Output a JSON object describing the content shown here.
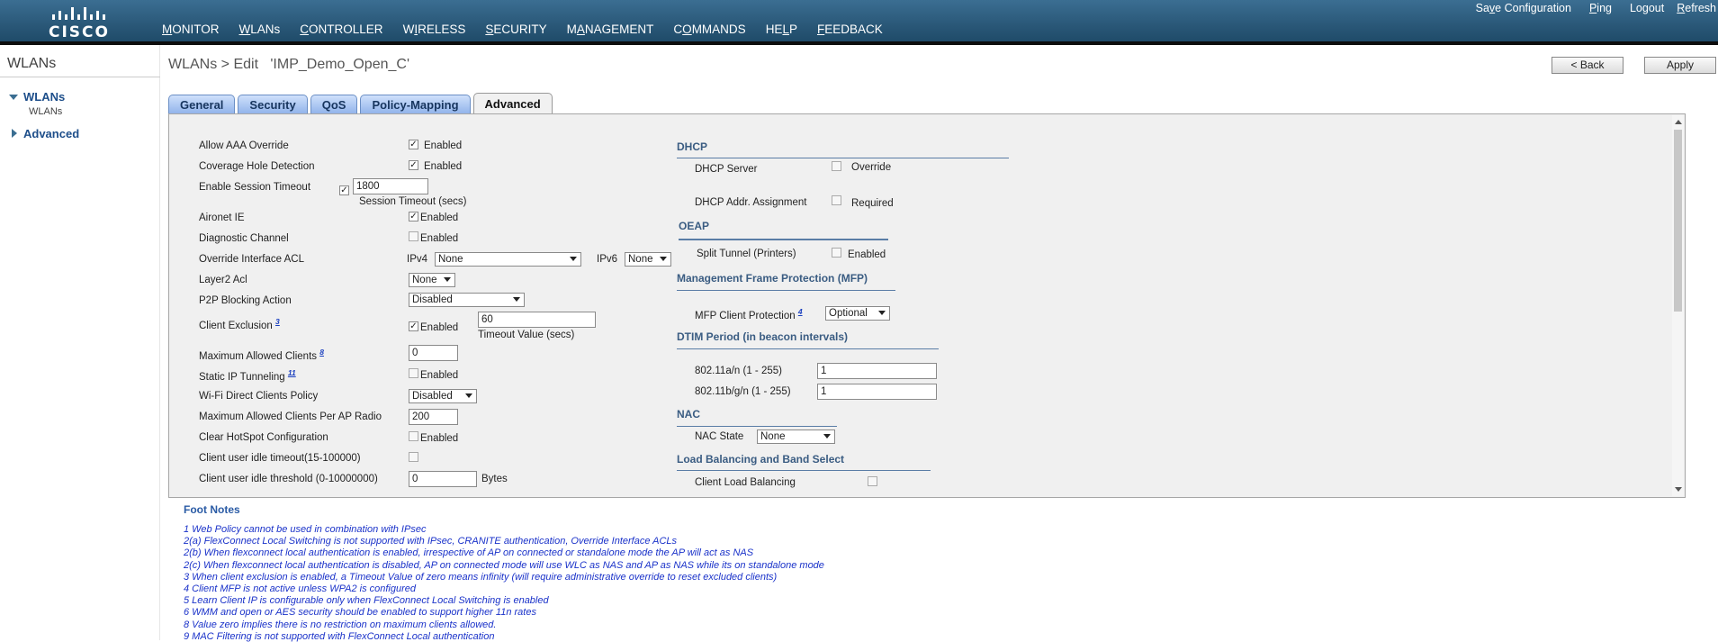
{
  "brand": "CISCO",
  "nav": {
    "main": [
      {
        "pre": "",
        "u": "M",
        "post": "ONITOR"
      },
      {
        "pre": "",
        "u": "W",
        "post": "LANs"
      },
      {
        "pre": "",
        "u": "C",
        "post": "ONTROLLER"
      },
      {
        "pre": "W",
        "u": "I",
        "post": "RELESS"
      },
      {
        "pre": "",
        "u": "S",
        "post": "ECURITY"
      },
      {
        "pre": "M",
        "u": "A",
        "post": "NAGEMENT"
      },
      {
        "pre": "C",
        "u": "O",
        "post": "MMANDS"
      },
      {
        "pre": "HE",
        "u": "L",
        "post": "P"
      },
      {
        "pre": "",
        "u": "F",
        "post": "EEDBACK"
      }
    ],
    "util": [
      {
        "pre": "Sa",
        "u": "v",
        "post": "e Configuration"
      },
      {
        "pre": "",
        "u": "P",
        "post": "ing"
      },
      {
        "pre": "Logout",
        "u": "",
        "post": ""
      },
      {
        "pre": "",
        "u": "R",
        "post": "efresh"
      }
    ]
  },
  "sidebar": {
    "title": "WLANs",
    "group": "WLANs",
    "sub": "WLANs",
    "advanced": "Advanced"
  },
  "breadcrumb": "WLANs > Edit   'IMP_Demo_Open_C'",
  "buttons": {
    "back": "< Back",
    "apply": "Apply"
  },
  "tabs": [
    "General",
    "Security",
    "QoS",
    "Policy-Mapping",
    "Advanced"
  ],
  "active_tab": "Advanced",
  "left": {
    "allow_aaa": {
      "label": "Allow AAA Override",
      "value": "Enabled"
    },
    "coverage_hole": {
      "label": "Coverage Hole Detection",
      "value": "Enabled"
    },
    "session_timeout": {
      "label": "Enable Session Timeout",
      "value": "1800",
      "caption": "Session Timeout (secs)"
    },
    "aironet": {
      "label": "Aironet IE",
      "value": "Enabled"
    },
    "diag": {
      "label": "Diagnostic Channel",
      "value": "Enabled"
    },
    "override_acl": {
      "label": "Override Interface ACL",
      "ipv4_label": "IPv4",
      "ipv4_value": "None",
      "ipv6_label": "IPv6",
      "ipv6_value": "None"
    },
    "layer2_acl": {
      "label": "Layer2 Acl",
      "value": "None"
    },
    "p2p": {
      "label": "P2P Blocking Action",
      "value": "Disabled"
    },
    "client_excl": {
      "label": "Client Exclusion",
      "note": "3",
      "value": "Enabled",
      "timeout": "60",
      "caption": "Timeout Value (secs)"
    },
    "max_clients": {
      "label": "Maximum Allowed Clients",
      "note": "8",
      "value": "0"
    },
    "static_ip": {
      "label": "Static IP Tunneling",
      "note": "11",
      "value": "Enabled"
    },
    "wifi_direct": {
      "label": "Wi-Fi Direct Clients Policy",
      "value": "Disabled"
    },
    "max_per_radio": {
      "label": "Maximum Allowed Clients Per AP Radio",
      "value": "200"
    },
    "hotspot": {
      "label": "Clear HotSpot Configuration",
      "value": "Enabled"
    },
    "idle_timeout": {
      "label": "Client user idle timeout(15-100000)"
    },
    "idle_threshold": {
      "label": "Client user idle threshold (0-10000000)",
      "value": "0",
      "unit": "Bytes"
    }
  },
  "right": {
    "dhcp": {
      "title": "DHCP",
      "server_label": "DHCP Server",
      "server_value": "Override",
      "assign_label": "DHCP Addr. Assignment",
      "assign_value": "Required"
    },
    "oeap": {
      "title": "OEAP",
      "split_label": "Split Tunnel (Printers)",
      "split_value": "Enabled"
    },
    "mfp": {
      "title": "Management Frame Protection (MFP)",
      "label": "MFP Client Protection",
      "note": "4",
      "value": "Optional"
    },
    "dtim": {
      "title": "DTIM Period (in beacon intervals)",
      "a_label": "802.11a/n (1 - 255)",
      "a_value": "1",
      "b_label": "802.11b/g/n (1 - 255)",
      "b_value": "1"
    },
    "nac": {
      "title": "NAC",
      "label": "NAC State",
      "value": "None"
    },
    "lb": {
      "title": "Load Balancing and Band Select",
      "label": "Client Load Balancing"
    }
  },
  "footnotes": {
    "title": "Foot Notes",
    "items": [
      "1 Web Policy cannot be used in combination with IPsec",
      "2(a) FlexConnect Local Switching is not supported with IPsec, CRANITE authentication, Override Interface ACLs",
      "2(b) When flexconnect local authentication is enabled, irrespective of AP on connected or standalone mode the AP will act as NAS",
      "2(c) When flexconnect local authentication is disabled, AP on connected mode will use WLC as NAS and AP as NAS while its on standalone mode",
      "3 When client exclusion is enabled, a Timeout Value of zero means infinity (will require administrative override to reset excluded clients)",
      "4 Client MFP is not active unless WPA2 is configured",
      "5 Learn Client IP is configurable only when FlexConnect Local Switching is enabled",
      "6 WMM and open or AES security should be enabled to support higher 11n rates",
      "8 Value zero implies there is no restriction on maximum clients allowed.",
      "9 MAC Filtering is not supported with FlexConnect Local authentication"
    ]
  }
}
